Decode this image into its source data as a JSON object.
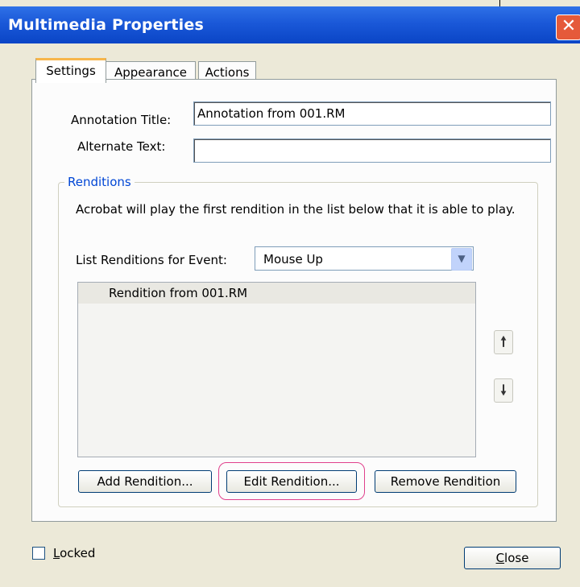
{
  "window": {
    "title": "Multimedia Properties",
    "close_glyph": "✕"
  },
  "tabs": [
    {
      "label": "Settings",
      "active": true
    },
    {
      "label": "Appearance",
      "active": false
    },
    {
      "label": "Actions",
      "active": false
    }
  ],
  "annotation_title": {
    "label": "Annotation Title:",
    "value": "Annotation from 001.RM"
  },
  "alternate_text": {
    "label": "Alternate Text:",
    "value": ""
  },
  "renditions": {
    "legend": "Renditions",
    "description": "Acrobat will play the first rendition in the list below that it is able to play.",
    "event_label": "List Renditions for Event:",
    "event_value": "Mouse Up",
    "items": [
      "Rendition from 001.RM"
    ],
    "move_up_icon": "arrow-up",
    "move_down_icon": "arrow-down",
    "buttons": {
      "add": "Add Rendition...",
      "edit": "Edit Rendition...",
      "remove": "Remove Rendition"
    }
  },
  "locked": {
    "label_first": "L",
    "label_rest": "ocked",
    "checked": false
  },
  "close_button": {
    "label_first": "C",
    "label_rest": "lose"
  },
  "colors": {
    "titlebar": "#0a45c6",
    "highlight": "#e0408c",
    "active_tab": "#f7b64b",
    "legend": "#0046d5"
  }
}
